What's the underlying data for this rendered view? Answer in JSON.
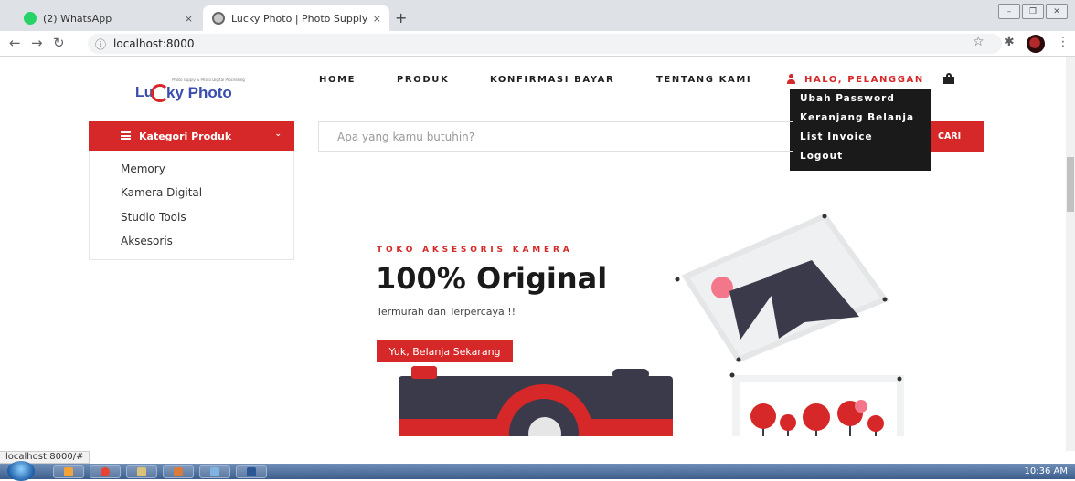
{
  "browser": {
    "tabs": [
      {
        "title": "(2) WhatsApp",
        "close": "×"
      },
      {
        "title": "Lucky Photo | Photo Supply & Photo Digital Processing",
        "close": "×"
      }
    ],
    "new_tab": "+",
    "url": "localhost:8000",
    "window_buttons": [
      "–",
      "❐",
      "✕"
    ]
  },
  "site": {
    "logo": {
      "part1": "Lu",
      "part2": "ky Photo",
      "tagline": "Photo supply & Photo Digital Processing"
    },
    "nav": {
      "home": "HOME",
      "produk": "PRODUK",
      "konfirmasi": "KONFIRMASI BAYAR",
      "tentang": "TENTANG KAMI",
      "user": "HALO, PELANGGAN"
    },
    "user_menu": [
      "Ubah Password",
      "Keranjang Belanja",
      "List Invoice",
      "Logout"
    ],
    "category": {
      "button": "Kategori Produk",
      "items": [
        "Memory",
        "Kamera Digital",
        "Studio Tools",
        "Aksesoris"
      ]
    },
    "search": {
      "placeholder": "Apa yang kamu butuhin?",
      "button": "CARI"
    },
    "hero": {
      "eyebrow": "TOKO AKSESORIS KAMERA",
      "headline": "100% Original",
      "tagline": "Termurah dan Terpercaya !!",
      "cta": "Yuk, Belanja Sekarang"
    }
  },
  "status_bar": "localhost:8000/#",
  "taskbar": {
    "clock": "10:36 AM"
  },
  "colors": {
    "accent": "#d62828",
    "dark": "#1a1a1a",
    "illustration": "#3b3a4a"
  }
}
